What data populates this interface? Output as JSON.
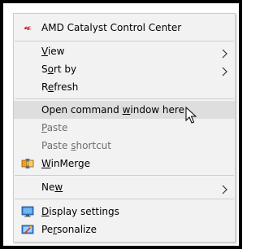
{
  "menu": {
    "items": [
      {
        "id": "amd",
        "pre": "AMD Catalyst Control Center",
        "acc": "",
        "post": ""
      },
      {
        "id": "view",
        "pre": "",
        "acc": "V",
        "post": "iew"
      },
      {
        "id": "sortby",
        "pre": "S",
        "acc": "o",
        "post": "rt by"
      },
      {
        "id": "refresh",
        "pre": "R",
        "acc": "e",
        "post": "fresh"
      },
      {
        "id": "open_cmd",
        "pre": "Open command ",
        "acc": "w",
        "post": "indow here"
      },
      {
        "id": "paste",
        "pre": "",
        "acc": "P",
        "post": "aste"
      },
      {
        "id": "paste_shortcut",
        "pre": "Paste ",
        "acc": "s",
        "post": "hortcut"
      },
      {
        "id": "winmerge",
        "pre": "",
        "acc": "W",
        "post": "inMerge"
      },
      {
        "id": "new",
        "pre": "Ne",
        "acc": "w",
        "post": ""
      },
      {
        "id": "display",
        "pre": "",
        "acc": "D",
        "post": "isplay settings"
      },
      {
        "id": "personalize",
        "pre": "Pe",
        "acc": "r",
        "post": "sonalize"
      }
    ]
  },
  "icons": {
    "amd": "amd-catalyst-icon",
    "winmerge": "winmerge-icon",
    "display": "display-settings-icon",
    "personalize": "personalize-icon",
    "submenu_arrow": "chevron-right-icon",
    "cursor": "mouse-pointer-icon"
  },
  "colors": {
    "highlight": "#dedede",
    "disabled_text": "#6d6d6d",
    "menu_bg": "#f2f2f2"
  }
}
